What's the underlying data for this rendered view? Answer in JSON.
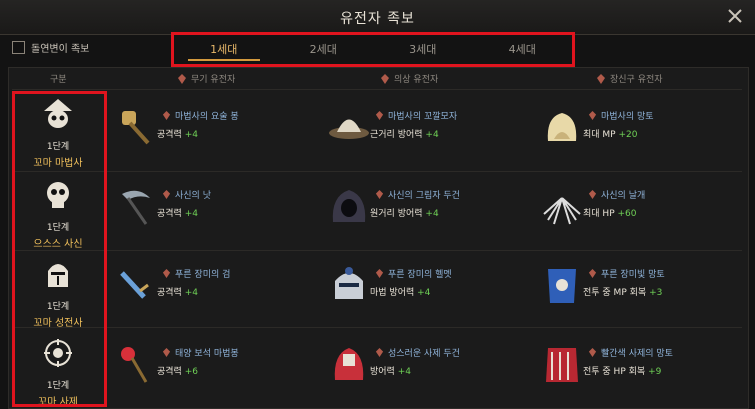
{
  "window": {
    "title": "유전자 족보"
  },
  "filter": {
    "mutant_label": "돌연변이 족보"
  },
  "tabs": [
    {
      "label": "1세대",
      "active": true
    },
    {
      "label": "2세대",
      "active": false
    },
    {
      "label": "3세대",
      "active": false
    },
    {
      "label": "4세대",
      "active": false
    }
  ],
  "headers": {
    "category": "구분",
    "weapon": "무기 유전자",
    "armor": "의상 유전자",
    "accessory": "장신구 유전자"
  },
  "rows": [
    {
      "level": "1단계",
      "class_name": "꼬마 마법사",
      "icon": "witch-skull-icon",
      "weapon": {
        "name": "마법사의 요술 봉",
        "stat": "공격력",
        "value": "+4",
        "icon": "wand-icon"
      },
      "armor": {
        "name": "마법사의 꼬깔모자",
        "stat": "근거리 방어력",
        "value": "+4",
        "icon": "wizard-hat-icon"
      },
      "accessory": {
        "name": "마법사의 망토",
        "stat": "최대 MP",
        "value": "+20",
        "icon": "cloak-icon"
      }
    },
    {
      "level": "1단계",
      "class_name": "으스스 사신",
      "icon": "skull-icon",
      "weapon": {
        "name": "사신의 낫",
        "stat": "공격력",
        "value": "+4",
        "icon": "scythe-icon"
      },
      "armor": {
        "name": "사신의 그림자 두건",
        "stat": "원거리 방어력",
        "value": "+4",
        "icon": "hood-icon"
      },
      "accessory": {
        "name": "사신의 날개",
        "stat": "최대 HP",
        "value": "+60",
        "icon": "wings-icon"
      }
    },
    {
      "level": "1단계",
      "class_name": "꼬마 성전사",
      "icon": "knight-helmet-icon",
      "weapon": {
        "name": "푸른 장미의 검",
        "stat": "공격력",
        "value": "+4",
        "icon": "sword-icon"
      },
      "armor": {
        "name": "푸른 장미의 헬멧",
        "stat": "마법 방어력",
        "value": "+4",
        "icon": "helmet-icon"
      },
      "accessory": {
        "name": "푸른 장미빛 망토",
        "stat": "전투 중 MP 회복",
        "value": "+3",
        "icon": "banner-cape-icon"
      }
    },
    {
      "level": "1단계",
      "class_name": "꼬마 사제",
      "icon": "holy-emblem-icon",
      "weapon": {
        "name": "태양 보석 마법봉",
        "stat": "공격력",
        "value": "+6",
        "icon": "sun-staff-icon"
      },
      "armor": {
        "name": "성스러운 사제 두건",
        "stat": "방어력",
        "value": "+4",
        "icon": "priest-hood-icon"
      },
      "accessory": {
        "name": "빨간색 사제의 망토",
        "stat": "전투 중 HP 회복",
        "value": "+9",
        "icon": "red-cape-icon"
      }
    }
  ]
}
